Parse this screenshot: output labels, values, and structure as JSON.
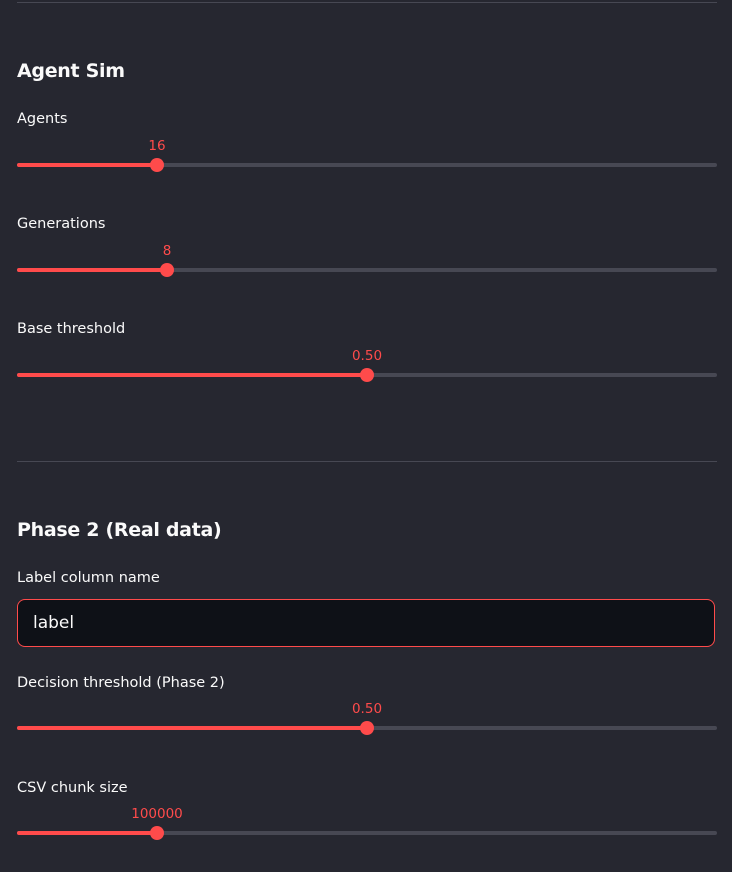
{
  "colors": {
    "accent": "#ff4b4b",
    "background": "#262730",
    "track": "#474853",
    "input_background": "#0e1117",
    "text": "#fafafa"
  },
  "agent_sim": {
    "title": "Agent Sim",
    "agents": {
      "label": "Agents",
      "value": "16",
      "fraction": 0.2
    },
    "generations": {
      "label": "Generations",
      "value": "8",
      "fraction": 0.214
    },
    "base_threshold": {
      "label": "Base threshold",
      "value": "0.50",
      "fraction": 0.5
    }
  },
  "phase2": {
    "title": "Phase 2 (Real data)",
    "label_column": {
      "label": "Label column name",
      "value": "label"
    },
    "decision_threshold": {
      "label": "Decision threshold (Phase 2)",
      "value": "0.50",
      "fraction": 0.5
    },
    "csv_chunk_size": {
      "label": "CSV chunk size",
      "value": "100000",
      "fraction": 0.2
    }
  }
}
